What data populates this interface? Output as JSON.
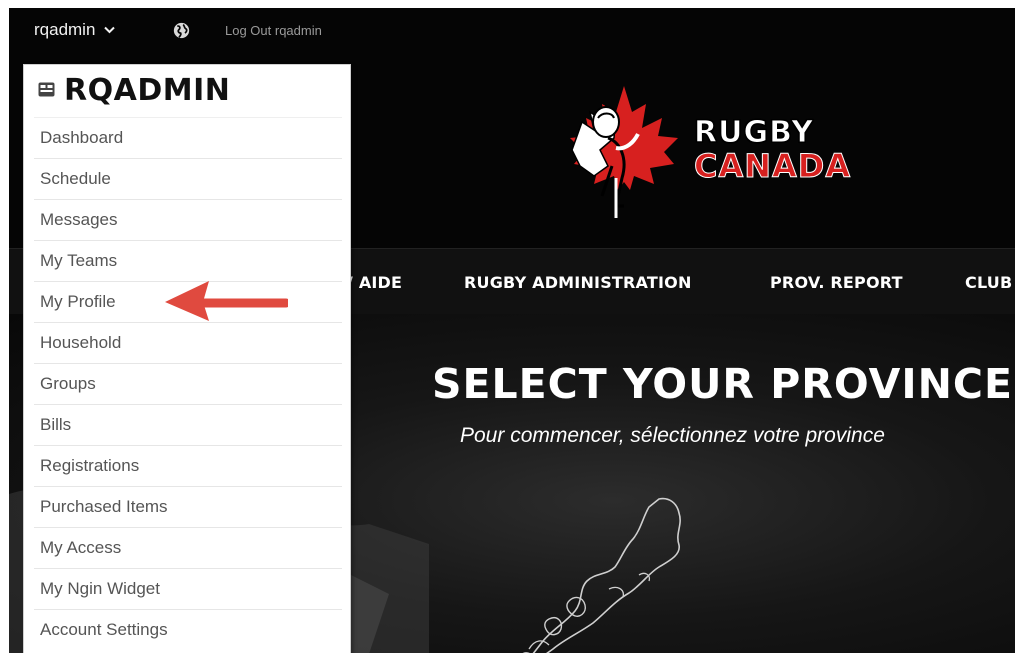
{
  "topbar": {
    "username": "rqadmin",
    "logout_label": "Log Out rqadmin"
  },
  "logo": {
    "line1": "RUGBY",
    "line2": "CANADA"
  },
  "nav": {
    "items": [
      {
        "label": "/ AIDE"
      },
      {
        "label": "RUGBY ADMINISTRATION"
      },
      {
        "label": "PROV. REPORT"
      },
      {
        "label": "CLUB"
      }
    ]
  },
  "hero": {
    "title": "SELECT YOUR PROVINCE",
    "subtitle": "Pour commencer, sélectionnez votre province"
  },
  "dropdown": {
    "title": "RQADMIN",
    "items": [
      {
        "label": "Dashboard"
      },
      {
        "label": "Schedule"
      },
      {
        "label": "Messages"
      },
      {
        "label": "My Teams"
      },
      {
        "label": "My Profile"
      },
      {
        "label": "Household"
      },
      {
        "label": "Groups"
      },
      {
        "label": "Bills"
      },
      {
        "label": "Registrations"
      },
      {
        "label": "Purchased Items"
      },
      {
        "label": "My Access"
      },
      {
        "label": "My Ngin Widget"
      },
      {
        "label": "Account Settings"
      }
    ]
  },
  "colors": {
    "brand_red": "#d7201f",
    "annotation_arrow": "#e04a3f",
    "page_bg": "#050505"
  },
  "icons": {
    "globe": "globe-icon",
    "chevron": "chevron-down-icon",
    "badge": "user-badge-icon"
  }
}
